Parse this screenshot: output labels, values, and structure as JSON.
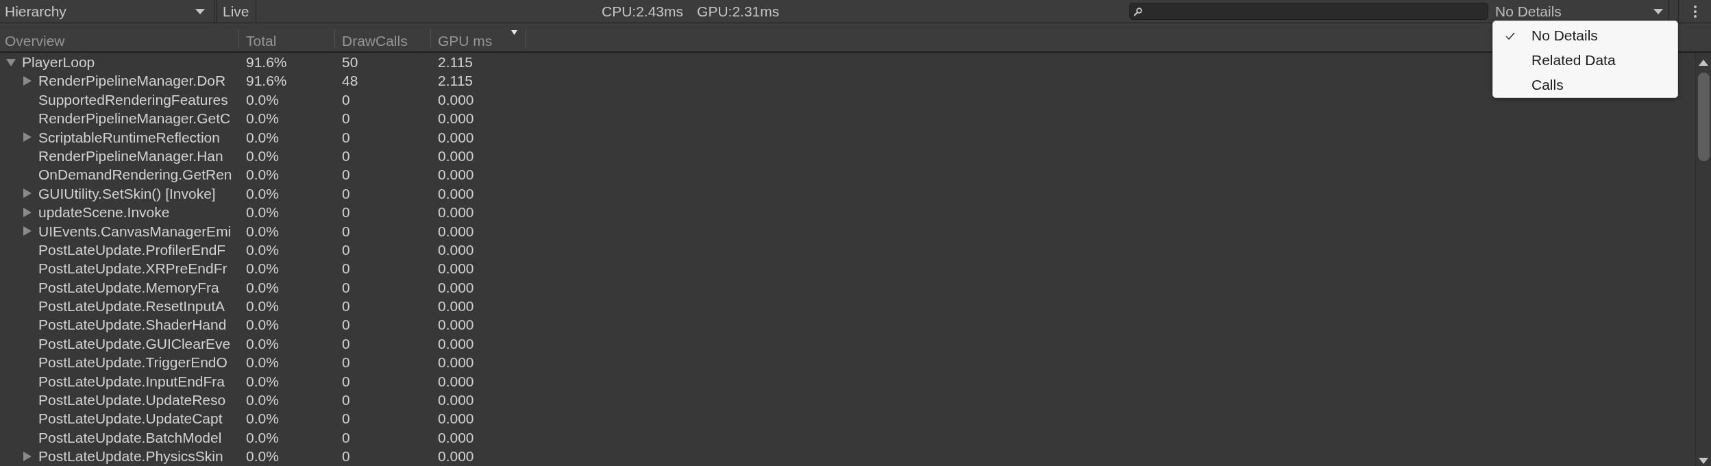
{
  "toolbar": {
    "view_dropdown": "Hierarchy",
    "live_button": "Live",
    "cpu_time": "CPU:2.43ms",
    "gpu_time": "GPU:2.31ms",
    "details_dropdown": {
      "label": "No Details",
      "expanded": true,
      "options": [
        {
          "label": "No Details",
          "selected": true
        },
        {
          "label": "Related Data",
          "selected": false
        },
        {
          "label": "Calls",
          "selected": false
        }
      ]
    }
  },
  "table": {
    "columns": [
      {
        "label": "Overview",
        "sorted": false
      },
      {
        "label": "Total",
        "sorted": false
      },
      {
        "label": "DrawCalls",
        "sorted": false
      },
      {
        "label": "GPU ms",
        "sorted": true
      }
    ],
    "rows": [
      {
        "name": "PlayerLoop",
        "kind": "node",
        "expanded": true,
        "values": [
          "91.6%",
          "50",
          "2.115"
        ],
        "children": [
          {
            "name": "RenderPipelineManager.DoR",
            "kind": "node",
            "expanded": false,
            "values": [
              "91.6%",
              "48",
              "2.115"
            ]
          },
          {
            "name": "SupportedRenderingFeatures",
            "kind": "leaf",
            "values": [
              "0.0%",
              "0",
              "0.000"
            ]
          },
          {
            "name": "RenderPipelineManager.GetC",
            "kind": "leaf",
            "values": [
              "0.0%",
              "0",
              "0.000"
            ]
          },
          {
            "name": "ScriptableRuntimeReflection",
            "kind": "node",
            "expanded": false,
            "values": [
              "0.0%",
              "0",
              "0.000"
            ]
          },
          {
            "name": "RenderPipelineManager.Han",
            "kind": "leaf",
            "values": [
              "0.0%",
              "0",
              "0.000"
            ]
          },
          {
            "name": "OnDemandRendering.GetRen",
            "kind": "leaf",
            "values": [
              "0.0%",
              "0",
              "0.000"
            ]
          },
          {
            "name": "GUIUtility.SetSkin() [Invoke]",
            "kind": "node",
            "expanded": false,
            "values": [
              "0.0%",
              "0",
              "0.000"
            ]
          },
          {
            "name": "updateScene.Invoke",
            "kind": "node",
            "expanded": false,
            "values": [
              "0.0%",
              "0",
              "0.000"
            ]
          },
          {
            "name": "UIEvents.CanvasManagerEmi",
            "kind": "node",
            "expanded": false,
            "values": [
              "0.0%",
              "0",
              "0.000"
            ]
          },
          {
            "name": "PostLateUpdate.ProfilerEndF",
            "kind": "leaf",
            "values": [
              "0.0%",
              "0",
              "0.000"
            ]
          },
          {
            "name": "PostLateUpdate.XRPreEndFr",
            "kind": "leaf",
            "values": [
              "0.0%",
              "0",
              "0.000"
            ]
          },
          {
            "name": "PostLateUpdate.MemoryFra",
            "kind": "leaf",
            "values": [
              "0.0%",
              "0",
              "0.000"
            ]
          },
          {
            "name": "PostLateUpdate.ResetInputA",
            "kind": "leaf",
            "values": [
              "0.0%",
              "0",
              "0.000"
            ]
          },
          {
            "name": "PostLateUpdate.ShaderHand",
            "kind": "leaf",
            "values": [
              "0.0%",
              "0",
              "0.000"
            ]
          },
          {
            "name": "PostLateUpdate.GUIClearEve",
            "kind": "leaf",
            "values": [
              "0.0%",
              "0",
              "0.000"
            ]
          },
          {
            "name": "PostLateUpdate.TriggerEndO",
            "kind": "leaf",
            "values": [
              "0.0%",
              "0",
              "0.000"
            ]
          },
          {
            "name": "PostLateUpdate.InputEndFra",
            "kind": "leaf",
            "values": [
              "0.0%",
              "0",
              "0.000"
            ]
          },
          {
            "name": "PostLateUpdate.UpdateReso",
            "kind": "leaf",
            "values": [
              "0.0%",
              "0",
              "0.000"
            ]
          },
          {
            "name": "PostLateUpdate.UpdateCapt",
            "kind": "leaf",
            "values": [
              "0.0%",
              "0",
              "0.000"
            ]
          },
          {
            "name": "PostLateUpdate.BatchModel",
            "kind": "leaf",
            "values": [
              "0.0%",
              "0",
              "0.000"
            ]
          },
          {
            "name": "PostLateUpdate.PhysicsSkin",
            "kind": "node",
            "expanded": false,
            "values": [
              "0.0%",
              "0",
              "0.000"
            ]
          }
        ]
      }
    ]
  }
}
